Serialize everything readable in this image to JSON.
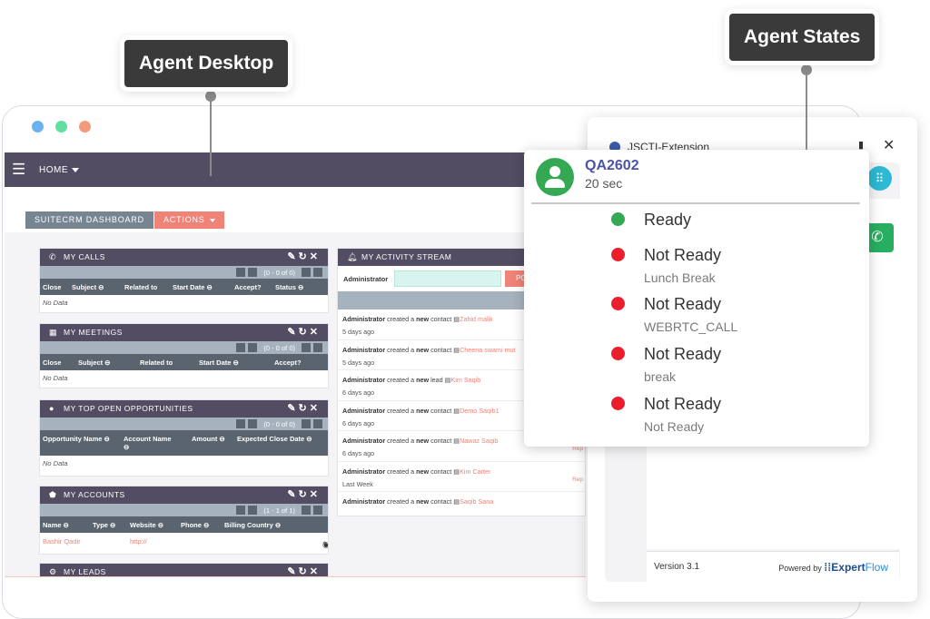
{
  "callouts": {
    "agent_desktop": "Agent Desktop",
    "agent_states": "Agent States"
  },
  "crm": {
    "nav": {
      "home": "HOME"
    },
    "tabs": {
      "dashboard": "SUITECRM DASHBOARD",
      "actions": "ACTIONS"
    },
    "calls": {
      "title": "MY CALLS",
      "pager": "(0 - 0 of 0)",
      "columns": [
        "Close",
        "Subject ⊖",
        "Related to",
        "Start Date ⊖",
        "Accept?",
        "Status ⊖"
      ],
      "empty": "No Data"
    },
    "meetings": {
      "title": "MY MEETINGS",
      "pager": "(0 - 0 of 0)",
      "columns": [
        "Close",
        "Subject ⊖",
        "Related to",
        "Start Date ⊖",
        "Accept?"
      ],
      "empty": "No Data"
    },
    "opportunities": {
      "title": "MY TOP OPEN OPPORTUNITIES",
      "pager": "(0 - 0 of 0)",
      "columns": [
        "Opportunity Name ⊖",
        "Account Name ⊖",
        "Amount ⊖",
        "Expected Close Date ⊖"
      ],
      "empty": "No Data"
    },
    "accounts": {
      "title": "MY ACCOUNTS",
      "pager": "(1 - 1 of 1)",
      "columns": [
        "Name ⊖",
        "Type ⊖",
        "Website ⊖",
        "Phone ⊖",
        "Billing Country ⊖"
      ],
      "row": {
        "name": "Bashir Qadir",
        "website": "http://"
      }
    },
    "leads": {
      "title": "MY LEADS"
    },
    "stream": {
      "title": "MY ACTIVITY STREAM",
      "filter_label": "Administrator",
      "post_label": "PO",
      "items": [
        {
          "actor": "Administrator",
          "verb": "created a",
          "kind": "new",
          "type": "contact",
          "target": "Zahid malik",
          "ago": "5 days ago",
          "reply": ""
        },
        {
          "actor": "Administrator",
          "verb": "created a",
          "kind": "new",
          "type": "contact",
          "target": "Cheena swami mut",
          "ago": "5 days ago",
          "reply": ""
        },
        {
          "actor": "Administrator",
          "verb": "created a",
          "kind": "new",
          "type": "lead",
          "target": "Kim Saqib",
          "ago": "6 days ago",
          "reply": ""
        },
        {
          "actor": "Administrator",
          "verb": "created a",
          "kind": "new",
          "type": "contact",
          "target": "Demo Saqib1",
          "ago": "6 days ago",
          "reply": ""
        },
        {
          "actor": "Administrator",
          "verb": "created a",
          "kind": "new",
          "type": "contact",
          "target": "Nawaz Saqib",
          "ago": "6 days ago",
          "reply": "Rep"
        },
        {
          "actor": "Administrator",
          "verb": "created a",
          "kind": "new",
          "type": "contact",
          "target": "Kim Carter",
          "ago": "Last Week",
          "reply": "Rep"
        },
        {
          "actor": "Administrator",
          "verb": "created a",
          "kind": "new",
          "type": "contact",
          "target": "Saqib Sana",
          "ago": "",
          "reply": ""
        }
      ]
    }
  },
  "extension": {
    "title": "JSCTI-Extension",
    "version": "Version 3.1",
    "powered_by": "Powered by",
    "brand_a": "Expert",
    "brand_b": "Flow"
  },
  "agent": {
    "name": "QA2602",
    "timer": "20 sec",
    "states": [
      {
        "label": "Ready",
        "sub": "",
        "color": "#34a853"
      },
      {
        "label": "Not Ready",
        "sub": "Lunch Break",
        "color": "#ea1f2b"
      },
      {
        "label": "Not Ready",
        "sub": "WEBRTC_CALL",
        "color": "#ea1f2b"
      },
      {
        "label": "Not Ready",
        "sub": "break",
        "color": "#ea1f2b"
      },
      {
        "label": "Not Ready",
        "sub": "Not Ready",
        "color": "#ea1f2b"
      }
    ]
  }
}
